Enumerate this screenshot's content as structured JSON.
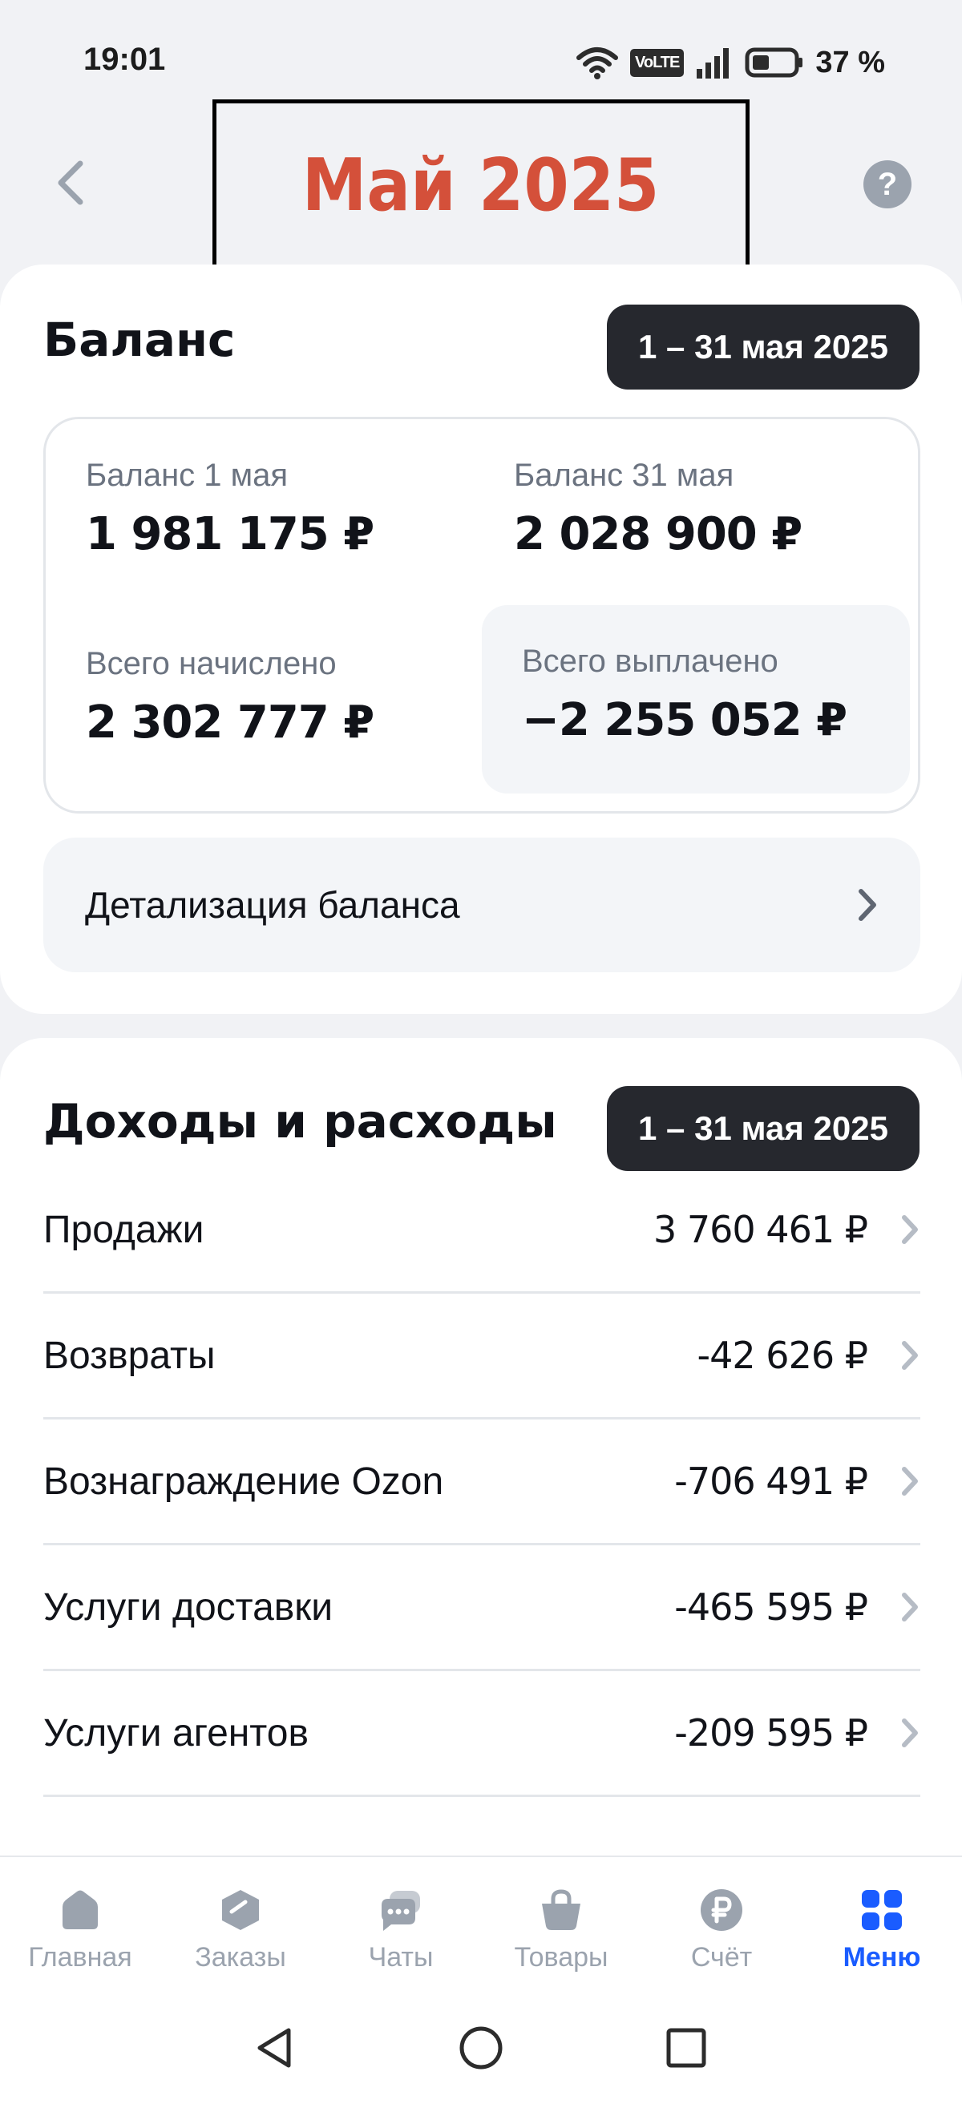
{
  "status": {
    "time": "19:01",
    "volte": "VoLTE",
    "battery_pct": "37 %"
  },
  "header": {
    "title": "Май 2025"
  },
  "balance": {
    "title": "Баланс",
    "date_range": "1 – 31 мая 2025",
    "start_label": "Баланс 1 мая",
    "start_value": "1 981 175 ₽",
    "end_label": "Баланс 31 мая",
    "end_value": "2 028 900 ₽",
    "accrued_label": "Всего начислено",
    "accrued_value": "2 302 777 ₽",
    "paid_label": "Всего выплачено",
    "paid_value": "−2 255 052 ₽",
    "detail_label": "Детализация баланса"
  },
  "income": {
    "title": "Доходы и расходы",
    "date_range": "1 – 31 мая 2025",
    "rows": [
      {
        "label": "Продажи",
        "value": "3 760 461 ₽"
      },
      {
        "label": "Возвраты",
        "value": "-42 626 ₽"
      },
      {
        "label": "Вознаграждение Ozon",
        "value": "-706 491 ₽"
      },
      {
        "label": "Услуги доставки",
        "value": "-465 595 ₽"
      },
      {
        "label": "Услуги агентов",
        "value": "-209 595 ₽"
      }
    ]
  },
  "nav": {
    "items": [
      {
        "label": "Главная",
        "icon": "home-icon"
      },
      {
        "label": "Заказы",
        "icon": "box-icon"
      },
      {
        "label": "Чаты",
        "icon": "chat-icon"
      },
      {
        "label": "Товары",
        "icon": "bag-icon"
      },
      {
        "label": "Счёт",
        "icon": "ruble-icon"
      },
      {
        "label": "Меню",
        "icon": "grid-icon"
      }
    ],
    "active": "Меню"
  },
  "colors": {
    "accent": "#1a5cff",
    "title": "#d4503a",
    "badge": "#26282e"
  }
}
